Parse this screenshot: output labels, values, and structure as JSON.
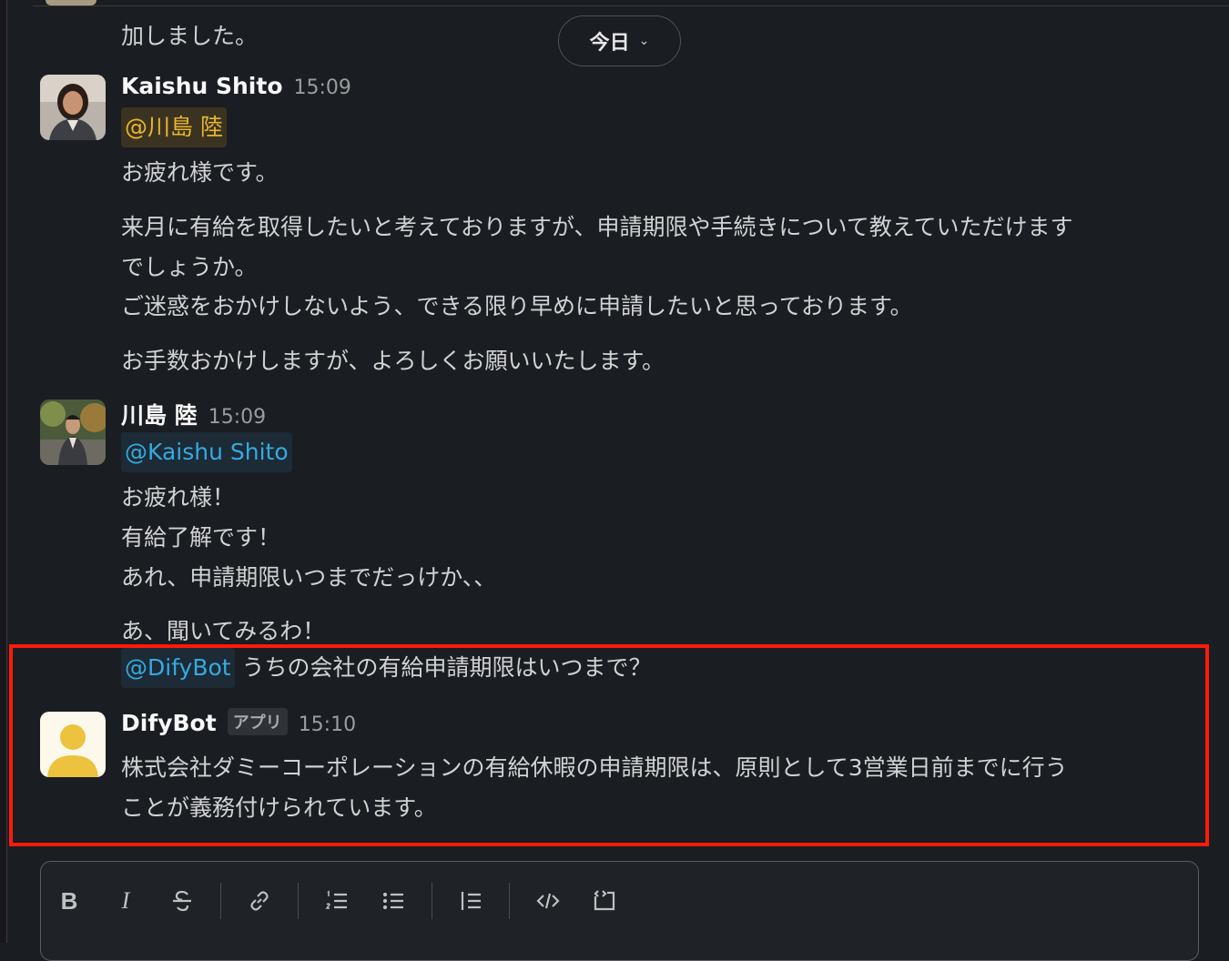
{
  "previous": {
    "text": "加しました。"
  },
  "date_divider": {
    "label": "今日"
  },
  "messages": [
    {
      "author": "Kaishu Shito",
      "time": "15:09",
      "mention": "@川島 陸",
      "lines": [
        "お疲れ様です。",
        "来月に有給を取得したいと考えておりますが、申請期限や手続きについて教えていただけます",
        "でしょうか。",
        "ご迷惑をおかけしないよう、できる限り早めに申請したいと思っております。",
        "お手数おかけしますが、よろしくお願いいたします。"
      ]
    },
    {
      "author": "川島 陸",
      "time": "15:09",
      "mention": "@Kaishu Shito",
      "lines": [
        "お疲れ様！",
        "有給了解です！",
        "あれ、申請期限いつまでだっけか、、",
        "あ、聞いてみるわ！"
      ],
      "bot_mention": "@DifyBot",
      "bot_question": " うちの会社の有給申請期限はいつまで？"
    },
    {
      "author": "DifyBot",
      "badge": "アプリ",
      "time": "15:10",
      "lines": [
        "株式会社ダミーコーポレーションの有給休暇の申請期限は、原則として3営業日前までに行う",
        "ことが義務付けられています。"
      ]
    }
  ],
  "composer": {
    "tools": [
      "bold-icon",
      "italic-icon",
      "strikethrough-icon",
      "link-icon",
      "ordered-list-icon",
      "bulleted-list-icon",
      "blockquote-icon",
      "code-icon",
      "code-block-icon"
    ]
  },
  "colors": {
    "background": "#1a1d21",
    "highlight_border": "#ff1a0a",
    "mention_self": "#e8b52e",
    "mention_other": "#36a9e0"
  }
}
